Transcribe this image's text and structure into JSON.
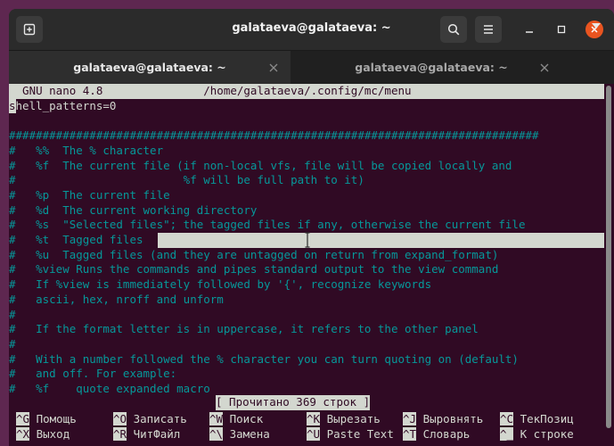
{
  "window": {
    "title": "galataeva@galataeva: ~"
  },
  "tabs": [
    {
      "label": "galataeva@galataeva: ~",
      "active": true
    },
    {
      "label": "galataeva@galataeva: ~",
      "active": false
    }
  ],
  "nano": {
    "header": "  GNU nano 4.8               /home/galataeva/.config/mc/menu",
    "cursor_char": "s",
    "first_line_rest": "hell_patterns=0",
    "lines": [
      "",
      "###############################################################################",
      "#   %%  The % character",
      "#   %f  The current file (if non-local vfs, file will be copied locally and",
      "#                         %f will be full path to it)",
      "#   %p  The current file",
      "#   %d  The current working directory",
      "#   %s  \"Selected files\"; the tagged files if any, otherwise the current file",
      "#   %t  Tagged files",
      "#   %u  Tagged files (and they are untagged on return from expand_format)",
      "#   %view Runs the commands and pipes standard output to the view command",
      "#   If %view is immediately followed by '{', recognize keywords",
      "#   ascii, hex, nroff and unform",
      "#",
      "#   If the format letter is in uppercase, it refers to the other panel",
      "#",
      "#   With a number followed the % character you can turn quoting on (default)",
      "#   and off. For example:",
      "#   %f    quote expanded macro"
    ],
    "status": "[ Прочитано 369 строк ]",
    "shortcuts_row1": [
      {
        "key": "^G",
        "label": " Помощь"
      },
      {
        "key": "^O",
        "label": " Записать"
      },
      {
        "key": "^W",
        "label": " Поиск"
      },
      {
        "key": "^K",
        "label": " Вырезать"
      },
      {
        "key": "^J",
        "label": " Выровнять"
      },
      {
        "key": "^C",
        "label": " ТекПозиц"
      }
    ],
    "shortcuts_row2": [
      {
        "key": "^X",
        "label": " Выход"
      },
      {
        "key": "^R",
        "label": " ЧитФайл"
      },
      {
        "key": "^\\",
        "label": " Замена"
      },
      {
        "key": "^U",
        "label": " Paste Text"
      },
      {
        "key": "^T",
        "label": " Словарь"
      },
      {
        "key": "^_",
        "label": " К строке"
      }
    ]
  },
  "colors": {
    "desktop": "#5e2750",
    "terminal_bg": "#300a24",
    "comment": "#06989a",
    "close_button": "#e95420"
  }
}
